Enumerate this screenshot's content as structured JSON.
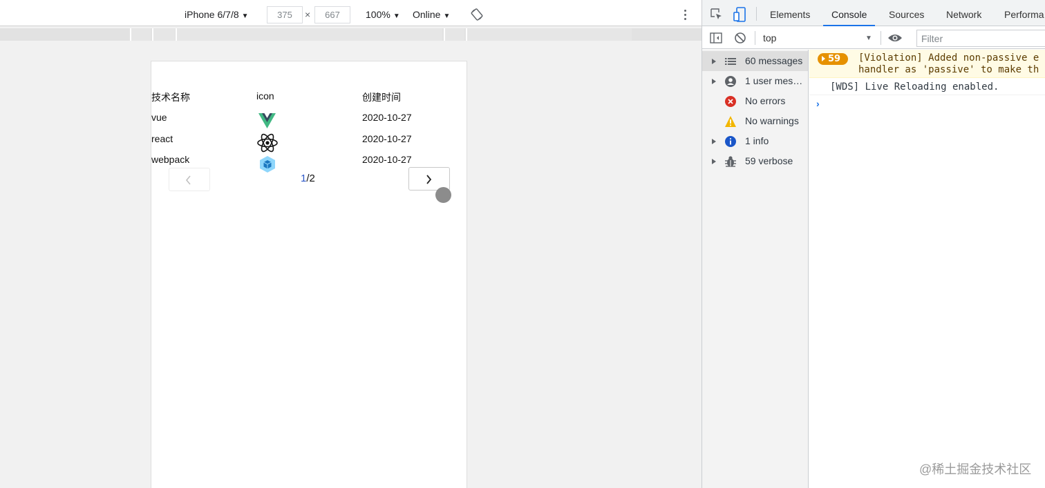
{
  "device_toolbar": {
    "device_name": "iPhone 6/7/8",
    "width_value": "375",
    "height_value": "667",
    "dimension_separator": "×",
    "zoom": "100%",
    "throttle": "Online",
    "caret": "▼"
  },
  "page": {
    "table": {
      "headers": [
        "技术名称",
        "icon",
        "创建时间"
      ],
      "rows": [
        {
          "name": "vue",
          "icon": "vue-logo-icon",
          "date": "2020-10-27"
        },
        {
          "name": "react",
          "icon": "react-logo-icon",
          "date": "2020-10-27"
        },
        {
          "name": "webpack",
          "icon": "webpack-logo-icon",
          "date": "2020-10-27"
        }
      ]
    },
    "pager": {
      "current": "1",
      "total_text": "/2"
    }
  },
  "devtools": {
    "tabs": [
      "Elements",
      "Console",
      "Sources",
      "Network",
      "Performa"
    ],
    "active_tab": "Console",
    "console_toolbar": {
      "context": "top",
      "filter_placeholder": "Filter"
    },
    "sidebar": [
      {
        "label": "60 messages",
        "icon": "list-icon",
        "expandable": true
      },
      {
        "label": "1 user mes…",
        "icon": "user-icon",
        "expandable": true
      },
      {
        "label": "No errors",
        "icon": "error-icon",
        "expandable": false
      },
      {
        "label": "No warnings",
        "icon": "warning-icon",
        "expandable": false
      },
      {
        "label": "1 info",
        "icon": "info-icon",
        "expandable": true
      },
      {
        "label": "59 verbose",
        "icon": "bug-icon",
        "expandable": true
      }
    ],
    "log": {
      "violation_count": "59",
      "violation_line1": "[Violation] Added non-passive e",
      "violation_line2": "handler as 'passive' to make th",
      "wds_message": "[WDS] Live Reloading enabled.",
      "prompt": "›"
    }
  },
  "watermark": "@稀土掘金技术社区",
  "colors": {
    "accent": "#1a73e8",
    "pager_current": "#2b56c8",
    "violation_bg": "#fffbe5",
    "violation_badge": "#e69100"
  }
}
